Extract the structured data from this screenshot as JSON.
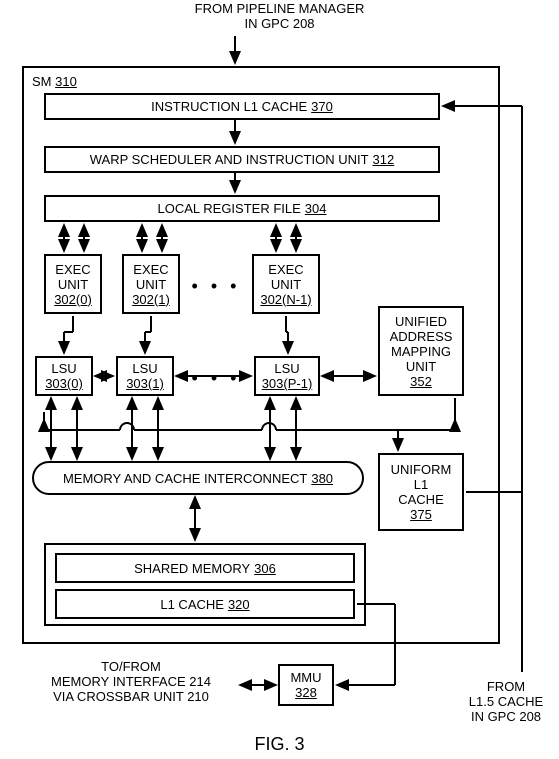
{
  "top_label": {
    "l1": "FROM PIPELINE MANAGER",
    "l2": "IN GPC 208"
  },
  "sm": {
    "name": "SM",
    "num": "310"
  },
  "il1": {
    "name": "INSTRUCTION L1 CACHE",
    "num": "370"
  },
  "warp": {
    "name": "WARP SCHEDULER AND INSTRUCTION UNIT",
    "num": "312"
  },
  "lrf": {
    "name": "LOCAL REGISTER FILE",
    "num": "304"
  },
  "exec": {
    "name": "EXEC",
    "unit": "UNIT",
    "n0": "302(0)",
    "n1": "302(1)",
    "nN": "302(N-1)"
  },
  "lsu": {
    "name": "LSU",
    "n0": "303(0)",
    "n1": "303(1)",
    "nP": "303(P-1)"
  },
  "dots": "• • •",
  "uamu": {
    "l1": "UNIFIED",
    "l2": "ADDRESS",
    "l3": "MAPPING",
    "l4": "UNIT",
    "num": "352"
  },
  "mci": {
    "name": "MEMORY AND CACHE INTERCONNECT",
    "num": "380"
  },
  "ul1": {
    "l1": "UNIFORM",
    "l2": "L1",
    "l3": "CACHE",
    "num": "375"
  },
  "shm": {
    "name": "SHARED MEMORY",
    "num": "306"
  },
  "l1c": {
    "name": "L1 CACHE",
    "num": "320"
  },
  "mmu": {
    "name": "MMU",
    "num": "328"
  },
  "bl_label": {
    "l1": "TO/FROM",
    "l2": "MEMORY INTERFACE 214",
    "l3": "VIA CROSSBAR UNIT 210"
  },
  "br_label": {
    "l1": "FROM",
    "l2": "L1.5 CACHE",
    "l3": "IN GPC 208"
  },
  "fig": "FIG. 3"
}
